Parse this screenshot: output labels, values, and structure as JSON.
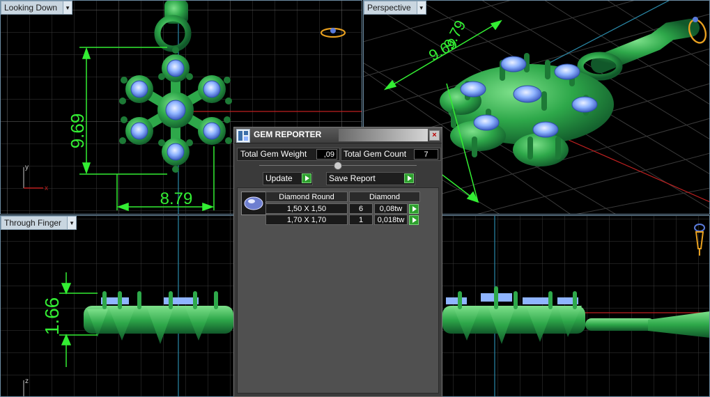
{
  "viewports": {
    "top": {
      "label": "Looking Down",
      "dim_vertical": "9.69",
      "dim_horizontal": "8.79",
      "axis_y": "y",
      "axis_x": "x"
    },
    "perspective": {
      "label": "Perspective",
      "dim_a": "9.69",
      "dim_b": "9.79"
    },
    "front": {
      "label": "Through Finger",
      "dim_vertical": "1.66",
      "axis_z": "z"
    }
  },
  "gem_reporter": {
    "title": "GEM REPORTER",
    "close_label": "×",
    "total_weight_label": "Total Gem Weight",
    "total_weight_value": ",09",
    "total_count_label": "Total Gem Count",
    "total_count_value": "7",
    "update_label": "Update",
    "save_report_label": "Save Report",
    "table": {
      "shape_header": "Diamond Round",
      "type_header": "Diamond",
      "rows": [
        {
          "size": "1,50 X 1,50",
          "count": "6",
          "weight": "0,08tw"
        },
        {
          "size": "1,70 X 1,70",
          "count": "1",
          "weight": "0,018tw"
        }
      ]
    }
  },
  "colors": {
    "background": "#000000",
    "grid": "#3a3a3a",
    "metal": "#2ea84a",
    "gem": "#8fb4ff",
    "dimension": "#33ee33",
    "accent_tab": "#c9d6e0"
  }
}
